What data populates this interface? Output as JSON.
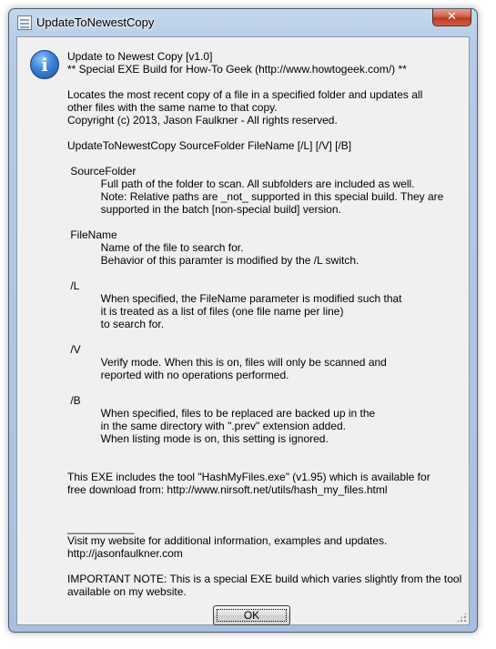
{
  "window": {
    "title": "UpdateToNewestCopy",
    "close_symbol": "✕"
  },
  "icons": {
    "app": "app-window-icon",
    "message": "information-icon",
    "message_glyph": "i"
  },
  "message": {
    "lines": [
      "Update to Newest Copy [v1.0]",
      "** Special EXE Build for How-To Geek (http://www.howtogeek.com/) **",
      "",
      "Locates the most recent copy of a file in a specified folder and updates all",
      "other files with the same name to that copy.",
      "Copyright (c) 2013, Jason Faulkner - All rights reserved.",
      "",
      "UpdateToNewestCopy SourceFolder FileName [/L] [/V] [/B]",
      "",
      " SourceFolder",
      "           Full path of the folder to scan. All subfolders are included as well.",
      "           Note: Relative paths are _not_ supported in this special build. They are",
      "           supported in the batch [non-special build] version.",
      "",
      " FileName",
      "           Name of the file to search for.",
      "           Behavior of this paramter is modified by the /L switch.",
      "",
      " /L",
      "           When specified, the FileName parameter is modified such that",
      "           it is treated as a list of files (one file name per line)",
      "           to search for.",
      "",
      " /V",
      "           Verify mode. When this is on, files will only be scanned and",
      "           reported with no operations performed.",
      "",
      " /B",
      "           When specified, files to be replaced are backed up in the",
      "           in the same directory with \".prev\" extension added.",
      "           When listing mode is on, this setting is ignored.",
      "",
      "",
      "This EXE includes the tool \"HashMyFiles.exe\" (v1.95) which is available for",
      "free download from: http://www.nirsoft.net/utils/hash_my_files.html",
      "",
      "",
      "___________",
      "Visit my website for additional information, examples and updates.",
      "http://jasonfaulkner.com",
      "",
      "IMPORTANT NOTE: This is a special EXE build which varies slightly from the tool",
      "available on my website."
    ]
  },
  "buttons": {
    "ok_label": "OK"
  }
}
